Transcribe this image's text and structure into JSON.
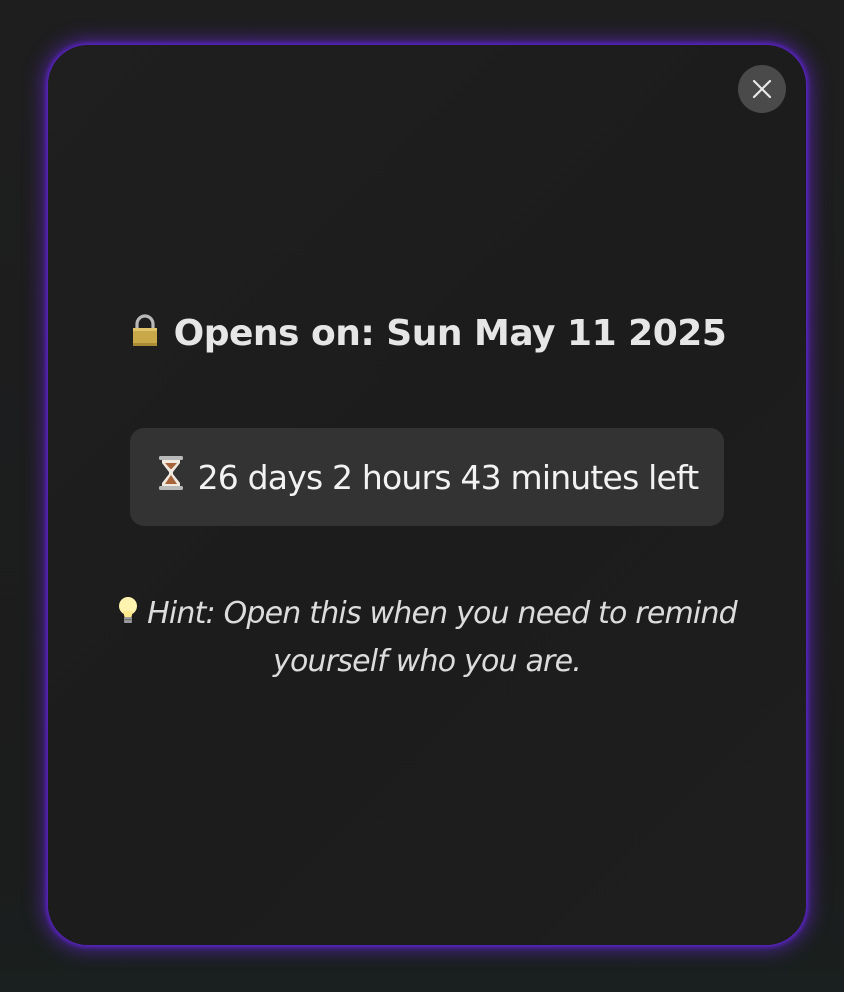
{
  "modal": {
    "title_label": "Opens on: Sun May 11 2025",
    "title_icon": "lock-icon",
    "countdown_label": "26 days 2 hours 43 minutes left",
    "countdown_icon": "hourglass-icon",
    "hint_text": "Hint: Open this when you need to remind yourself who you are.",
    "hint_icon": "lightbulb-icon",
    "close_icon": "close-icon"
  },
  "colors": {
    "glow": "#5b23c8",
    "modal_bg": "#1e1e1e",
    "close_bg": "#4a4a4b",
    "countdown_bg": "#333334",
    "text": "#e6e6e6"
  }
}
